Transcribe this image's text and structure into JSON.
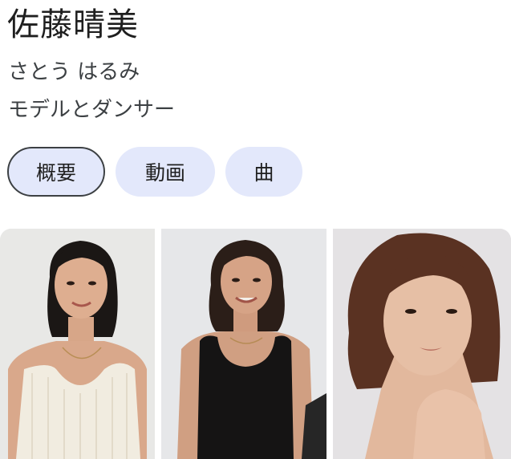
{
  "entity": {
    "name": "佐藤晴美",
    "reading": "さとう はるみ",
    "description": "モデルとダンサー"
  },
  "chips": [
    {
      "label": "概要",
      "active": true
    },
    {
      "label": "動画",
      "active": false
    },
    {
      "label": "曲",
      "active": false
    }
  ],
  "images": [
    {
      "icon": "portrait-photo"
    },
    {
      "icon": "portrait-photo"
    },
    {
      "icon": "portrait-photo"
    }
  ],
  "colors": {
    "chip_bg": "#e3e8fb",
    "chip_active_border": "#3c4043",
    "title": "#1f1f1f"
  }
}
